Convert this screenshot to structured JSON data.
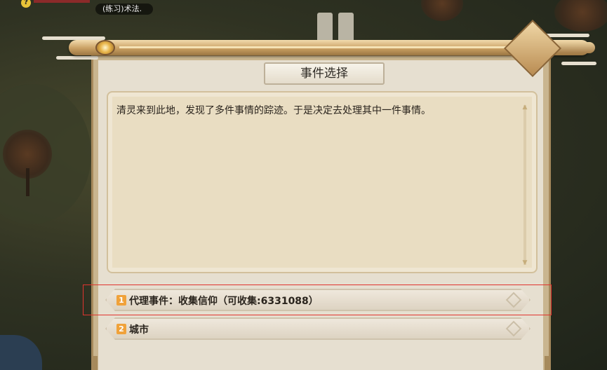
{
  "hud": {
    "alert_glyph": "?",
    "skill_label": "(练习)术法."
  },
  "dialog": {
    "title": "事件选择",
    "description": "清灵来到此地，发现了多件事情的踪迹。于是决定去处理其中一件事情。"
  },
  "options": [
    {
      "number": "1",
      "label": "代理事件：收集信仰（可收集:6331088）"
    },
    {
      "number": "2",
      "label": "城市"
    }
  ],
  "colors": {
    "highlight_border": "#e0342f",
    "option_number_bg": "#f0a23a",
    "panel_frame": "#c9b58f"
  }
}
